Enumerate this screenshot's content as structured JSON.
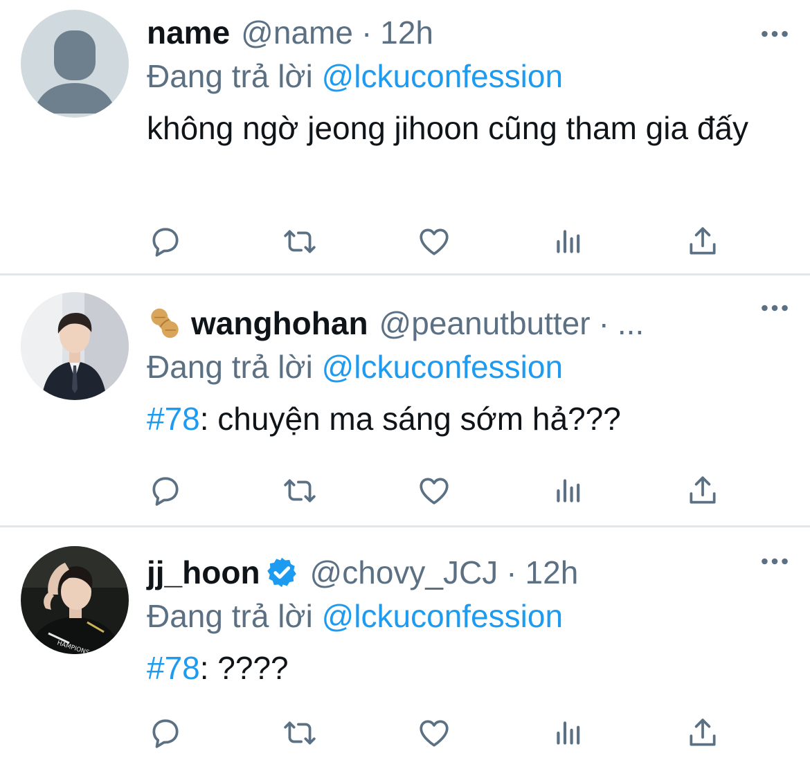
{
  "tweets": [
    {
      "name": "name",
      "handle": "@name",
      "separator": "·",
      "time": "12h",
      "reply_prefix": "Đang trả lời",
      "reply_to": "@lckuconfession",
      "text": "không ngờ jeong jihoon cũng tham gia đấy",
      "avatar": "default-profile-icon"
    },
    {
      "name": "wanghohan",
      "name_emoji": "peanut-emoji",
      "handle": "@peanutbutter",
      "separator": "·",
      "time": "...",
      "reply_prefix": "Đang trả lời",
      "reply_to": "@lckuconfession",
      "hashtag": "#78",
      "text": ": chuyện ma sáng sớm hả???",
      "avatar": "photo-man-in-suit"
    },
    {
      "name": "jj_hoon",
      "verified": true,
      "handle": "@chovy_JCJ",
      "separator": "·",
      "time": "12h",
      "reply_prefix": "Đang trả lời",
      "reply_to": "@lckuconfession",
      "hashtag": "#78",
      "text": ": ????",
      "avatar": "photo-player-in-jersey"
    }
  ],
  "actions": [
    "reply-icon",
    "retweet-icon",
    "like-icon",
    "analytics-icon",
    "share-icon"
  ],
  "colors": {
    "accent": "#1d9bf0",
    "secondary_text": "#5b7083",
    "primary_text": "#0f1419",
    "divider": "#e1e6ea",
    "icon": "#5b7083"
  }
}
